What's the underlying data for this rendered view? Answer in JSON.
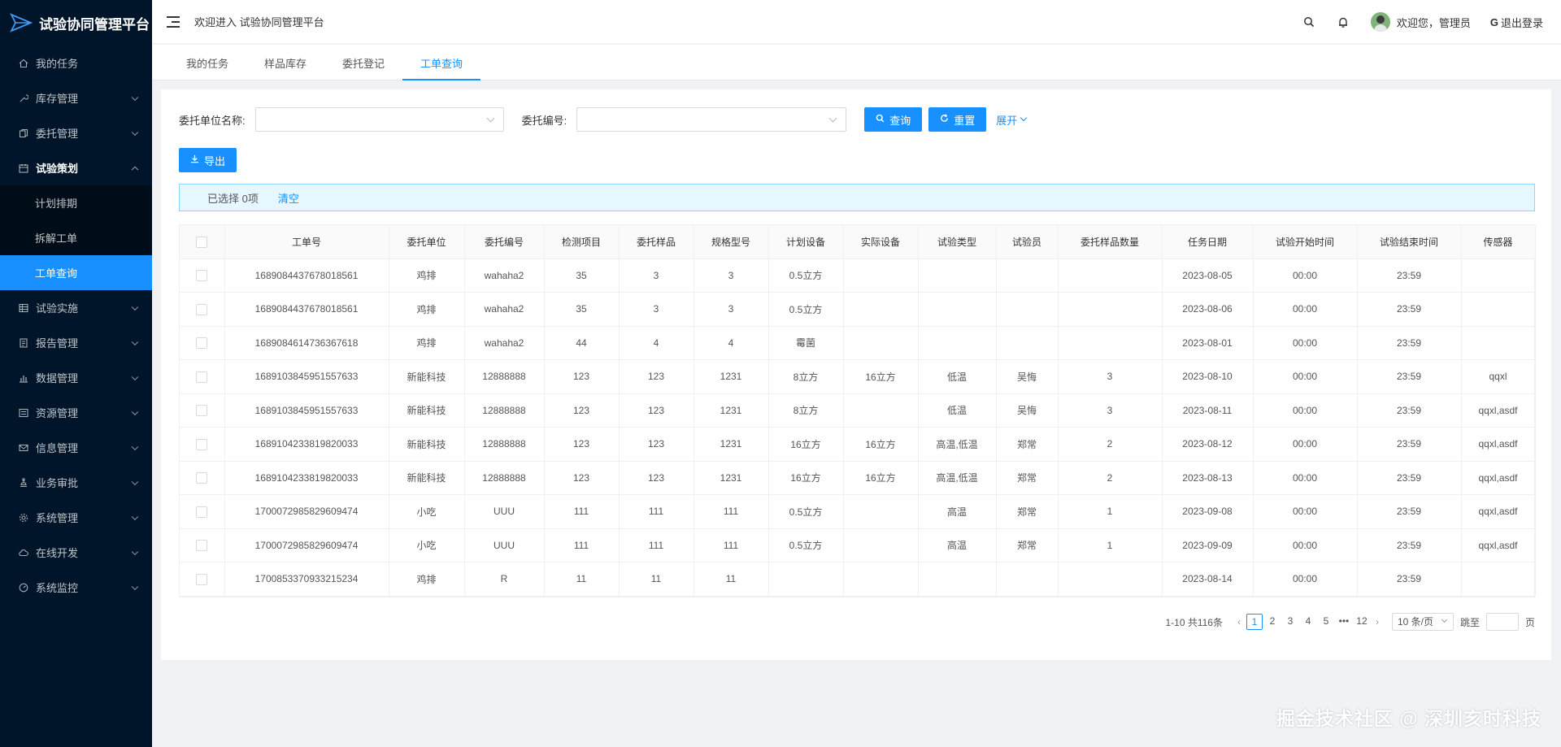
{
  "app": {
    "title": "试验协同管理平台"
  },
  "sidebar": {
    "items": [
      {
        "label": "我的任务",
        "icon": "home-icon",
        "has_arrow": false
      },
      {
        "label": "库存管理",
        "icon": "tool-icon",
        "has_arrow": true
      },
      {
        "label": "委托管理",
        "icon": "copy-icon",
        "has_arrow": true
      },
      {
        "label": "试验策划",
        "icon": "calendar-icon",
        "has_arrow": true,
        "open": true,
        "children": [
          {
            "label": "计划排期",
            "active": false
          },
          {
            "label": "拆解工单",
            "active": false
          },
          {
            "label": "工单查询",
            "active": true
          }
        ]
      },
      {
        "label": "试验实施",
        "icon": "table-icon",
        "has_arrow": true
      },
      {
        "label": "报告管理",
        "icon": "report-icon",
        "has_arrow": true
      },
      {
        "label": "数据管理",
        "icon": "bar-chart-icon",
        "has_arrow": true
      },
      {
        "label": "资源管理",
        "icon": "list-icon",
        "has_arrow": true
      },
      {
        "label": "信息管理",
        "icon": "mail-icon",
        "has_arrow": true
      },
      {
        "label": "业务审批",
        "icon": "stamp-icon",
        "has_arrow": true
      },
      {
        "label": "系统管理",
        "icon": "setting-icon",
        "has_arrow": true
      },
      {
        "label": "在线开发",
        "icon": "cloud-icon",
        "has_arrow": true
      },
      {
        "label": "系统监控",
        "icon": "dashboard-icon",
        "has_arrow": true
      }
    ]
  },
  "header": {
    "welcome": "欢迎进入 试验协同管理平台",
    "user": "欢迎您，管理员",
    "logout": "退出登录"
  },
  "tabs": [
    {
      "label": "我的任务",
      "active": false
    },
    {
      "label": "样品库存",
      "active": false
    },
    {
      "label": "委托登记",
      "active": false
    },
    {
      "label": "工单查询",
      "active": true
    }
  ],
  "search": {
    "unit_label": "委托单位名称:",
    "code_label": "委托编号:",
    "query": "查询",
    "reset": "重置",
    "expand": "展开",
    "export": "导出"
  },
  "alert": {
    "selected": "已选择 0项",
    "clear": "清空"
  },
  "table": {
    "columns": [
      "工单号",
      "委托单位",
      "委托编号",
      "检测项目",
      "委托样品",
      "规格型号",
      "计划设备",
      "实际设备",
      "试验类型",
      "试验员",
      "委托样品数量",
      "任务日期",
      "试验开始时间",
      "试验结束时间",
      "传感器"
    ],
    "rows": [
      [
        "1689084437678018561",
        "鸡排",
        "wahaha2",
        "35",
        "3",
        "3",
        "0.5立方",
        "",
        "",
        "",
        "",
        "2023-08-05",
        "00:00",
        "23:59",
        ""
      ],
      [
        "1689084437678018561",
        "鸡排",
        "wahaha2",
        "35",
        "3",
        "3",
        "0.5立方",
        "",
        "",
        "",
        "",
        "2023-08-06",
        "00:00",
        "23:59",
        ""
      ],
      [
        "1689084614736367618",
        "鸡排",
        "wahaha2",
        "44",
        "4",
        "4",
        "霉菌",
        "",
        "",
        "",
        "",
        "2023-08-01",
        "00:00",
        "23:59",
        ""
      ],
      [
        "1689103845951557633",
        "新能科技",
        "12888888",
        "123",
        "123",
        "1231",
        "8立方",
        "16立方",
        "低温",
        "吴悔",
        "3",
        "2023-08-10",
        "00:00",
        "23:59",
        "qqxl"
      ],
      [
        "1689103845951557633",
        "新能科技",
        "12888888",
        "123",
        "123",
        "1231",
        "8立方",
        "",
        "低温",
        "吴悔",
        "3",
        "2023-08-11",
        "00:00",
        "23:59",
        "qqxl,asdf"
      ],
      [
        "1689104233819820033",
        "新能科技",
        "12888888",
        "123",
        "123",
        "1231",
        "16立方",
        "16立方",
        "高温,低温",
        "郑常",
        "2",
        "2023-08-12",
        "00:00",
        "23:59",
        "qqxl,asdf"
      ],
      [
        "1689104233819820033",
        "新能科技",
        "12888888",
        "123",
        "123",
        "1231",
        "16立方",
        "16立方",
        "高温,低温",
        "郑常",
        "2",
        "2023-08-13",
        "00:00",
        "23:59",
        "qqxl,asdf"
      ],
      [
        "1700072985829609474",
        "小吃",
        "UUU",
        "111",
        "111",
        "111",
        "0.5立方",
        "",
        "高温",
        "郑常",
        "1",
        "2023-09-08",
        "00:00",
        "23:59",
        "qqxl,asdf"
      ],
      [
        "1700072985829609474",
        "小吃",
        "UUU",
        "111",
        "111",
        "111",
        "0.5立方",
        "",
        "高温",
        "郑常",
        "1",
        "2023-09-09",
        "00:00",
        "23:59",
        "qqxl,asdf"
      ],
      [
        "1700853370933215234",
        "鸡排",
        "R",
        "11",
        "11",
        "11",
        "",
        "",
        "",
        "",
        "",
        "2023-08-14",
        "00:00",
        "23:59",
        ""
      ]
    ]
  },
  "pagination": {
    "total": "1-10 共116条",
    "pages": [
      "1",
      "2",
      "3",
      "4",
      "5",
      "•••",
      "12"
    ],
    "current": "1",
    "page_size": "10 条/页",
    "jump_label": "跳至",
    "page_unit": "页"
  },
  "watermark": "掘金技术社区 @ 深圳亥时科技",
  "colors": {
    "primary": "#1890ff",
    "sidebar_bg": "#001529",
    "submenu_bg": "#000c17"
  }
}
